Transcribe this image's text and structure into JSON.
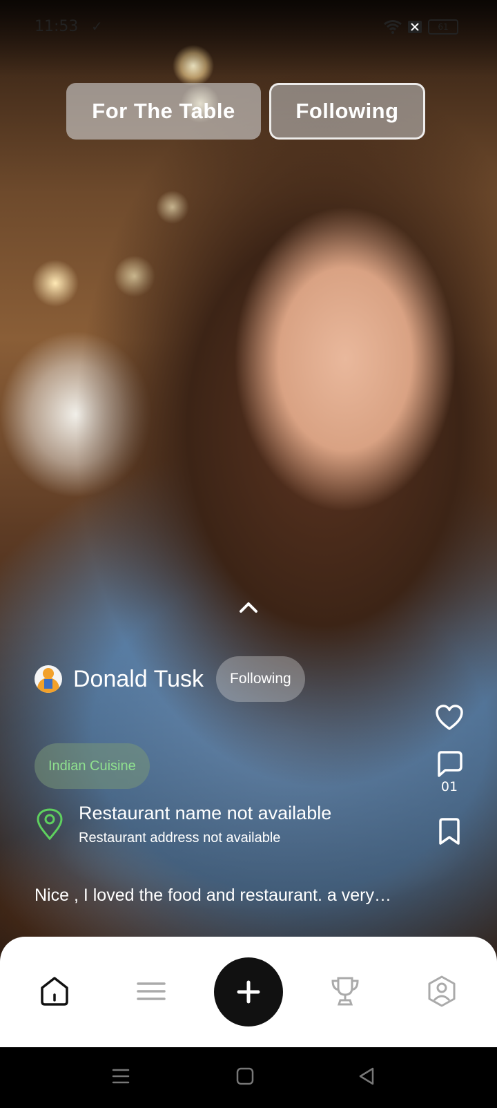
{
  "status_bar": {
    "time": "11:53",
    "battery": "61"
  },
  "tabs": [
    {
      "label": "For The Table",
      "active": false
    },
    {
      "label": "Following",
      "active": true
    }
  ],
  "post": {
    "user_name": "Donald Tusk",
    "follow_status": "Following",
    "cuisine": "Indian Cuisine",
    "restaurant_name": "Restaurant name not available",
    "restaurant_address": "Restaurant address not available",
    "caption": "Nice , I loved the food and restaurant. a very…",
    "comment_count": "01"
  },
  "bottom_nav": [
    "home-icon",
    "menu-icon",
    "plus-icon",
    "trophy-icon",
    "profile-icon"
  ],
  "colors": {
    "accent_dark": "#111111",
    "cuisine_text": "#8fe08f"
  }
}
